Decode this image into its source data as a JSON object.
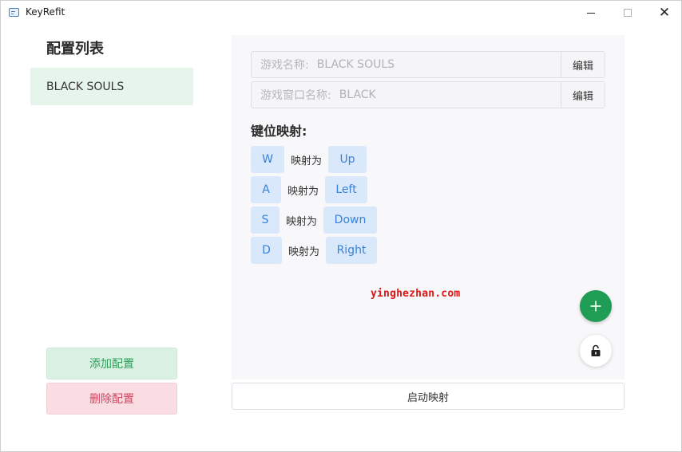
{
  "window": {
    "title": "KeyRefit"
  },
  "sidebar": {
    "title": "配置列表",
    "profiles": [
      {
        "label": "BLACK SOULS"
      }
    ],
    "add_label": "添加配置",
    "delete_label": "删除配置"
  },
  "main": {
    "game_name": {
      "label": "游戏名称:",
      "value": "BLACK SOULS",
      "edit_label": "编辑"
    },
    "window_name": {
      "label": "游戏窗口名称:",
      "value": "BLACK",
      "edit_label": "编辑"
    },
    "mapping_title": "键位映射:",
    "mappings": [
      {
        "from": "W",
        "connector": "映射为",
        "to": "Up"
      },
      {
        "from": "A",
        "connector": "映射为",
        "to": "Left"
      },
      {
        "from": "S",
        "connector": "映射为",
        "to": "Down"
      },
      {
        "from": "D",
        "connector": "映射为",
        "to": "Right"
      }
    ],
    "watermark": "yinghezhan.com",
    "start_label": "启动映射"
  },
  "icons": {
    "add": "plus-icon",
    "lock": "unlock-icon",
    "app": "keyboard-icon"
  },
  "colors": {
    "accent_green": "#1f9d55",
    "key_chip_bg": "#d9e8fb",
    "key_chip_text": "#3a82d8",
    "delete_text": "#d0455f",
    "add_text": "#2e9e5a"
  }
}
